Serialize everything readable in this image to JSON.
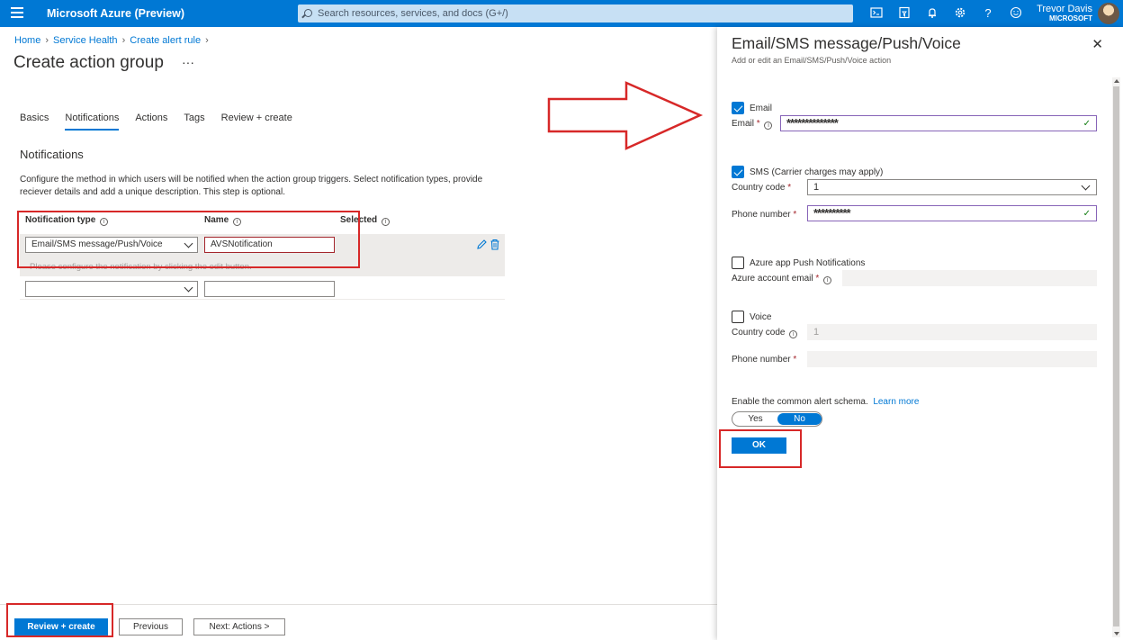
{
  "topbar": {
    "brand": "Microsoft Azure (Preview)",
    "search_placeholder": "Search resources, services, and docs (G+/)",
    "user_name": "Trevor Davis",
    "user_org": "MICROSOFT",
    "icons": [
      "cloud-shell-icon",
      "directory-filter-icon",
      "notifications-icon",
      "settings-icon",
      "help-icon",
      "feedback-icon"
    ]
  },
  "breadcrumb": [
    "Home",
    "Service Health",
    "Create alert rule"
  ],
  "page": {
    "title": "Create action group",
    "more": "···",
    "tabs": [
      "Basics",
      "Notifications",
      "Actions",
      "Tags",
      "Review + create"
    ],
    "active_tab": "Notifications",
    "section_title": "Notifications",
    "description": "Configure the method in which users will be notified when the action group triggers. Select notification types, provide reciever details and add a unique description. This step is optional.",
    "columns": {
      "type": "Notification type",
      "name": "Name",
      "selected": "Selected"
    },
    "rows": [
      {
        "type": "Email/SMS message/Push/Voice",
        "name": "AVSNotification",
        "warning": "Please configure the notification by clicking the edit button."
      },
      {
        "type": "",
        "name": ""
      }
    ]
  },
  "footer": {
    "review_create": "Review + create",
    "previous": "Previous",
    "next": "Next: Actions >"
  },
  "panel": {
    "title": "Email/SMS message/Push/Voice",
    "subtitle": "Add or edit an Email/SMS/Push/Voice action",
    "email_checkbox": "Email",
    "email_checked": true,
    "email_label": "Email",
    "email_value": "**************",
    "sms_checkbox": "SMS (Carrier charges may apply)",
    "sms_checked": true,
    "sms_country_label": "Country code",
    "sms_country_value": "1",
    "sms_phone_label": "Phone number",
    "sms_phone_value": "**********",
    "push_checkbox": "Azure app Push Notifications",
    "push_checked": false,
    "push_email_label": "Azure account email",
    "voice_checkbox": "Voice",
    "voice_checked": false,
    "voice_country_label": "Country code",
    "voice_country_value": "1",
    "voice_phone_label": "Phone number",
    "schema_label": "Enable the common alert schema.",
    "learn_more": "Learn more",
    "toggle_yes": "Yes",
    "toggle_no": "No",
    "toggle_selected": "No",
    "ok": "OK"
  },
  "colors": {
    "accent": "#0078d4",
    "annotation_red": "#d72828",
    "valid_border": "#8764b8"
  }
}
